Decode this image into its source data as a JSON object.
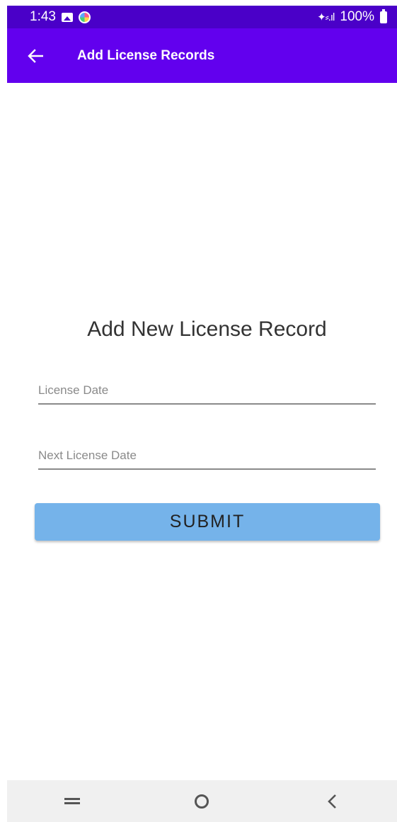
{
  "status_bar": {
    "time": "1:43",
    "signal": "✦⸗.ıl",
    "battery": "100%"
  },
  "app_bar": {
    "title": "Add License Records",
    "back_icon": "arrow-left-icon"
  },
  "form": {
    "heading": "Add New License Record",
    "license_date_placeholder": "License Date",
    "next_license_date_placeholder": "Next License Date",
    "submit_label": "SUBMIT"
  },
  "nav_bar": {
    "recents_icon": "recents-icon",
    "home_icon": "home-icon",
    "back_icon": "chevron-left-icon"
  },
  "colors": {
    "status_bar": "#4a00c8",
    "app_bar": "#6200ee",
    "submit_button": "#75b3ea",
    "nav_bar": "#f0f0f0"
  }
}
